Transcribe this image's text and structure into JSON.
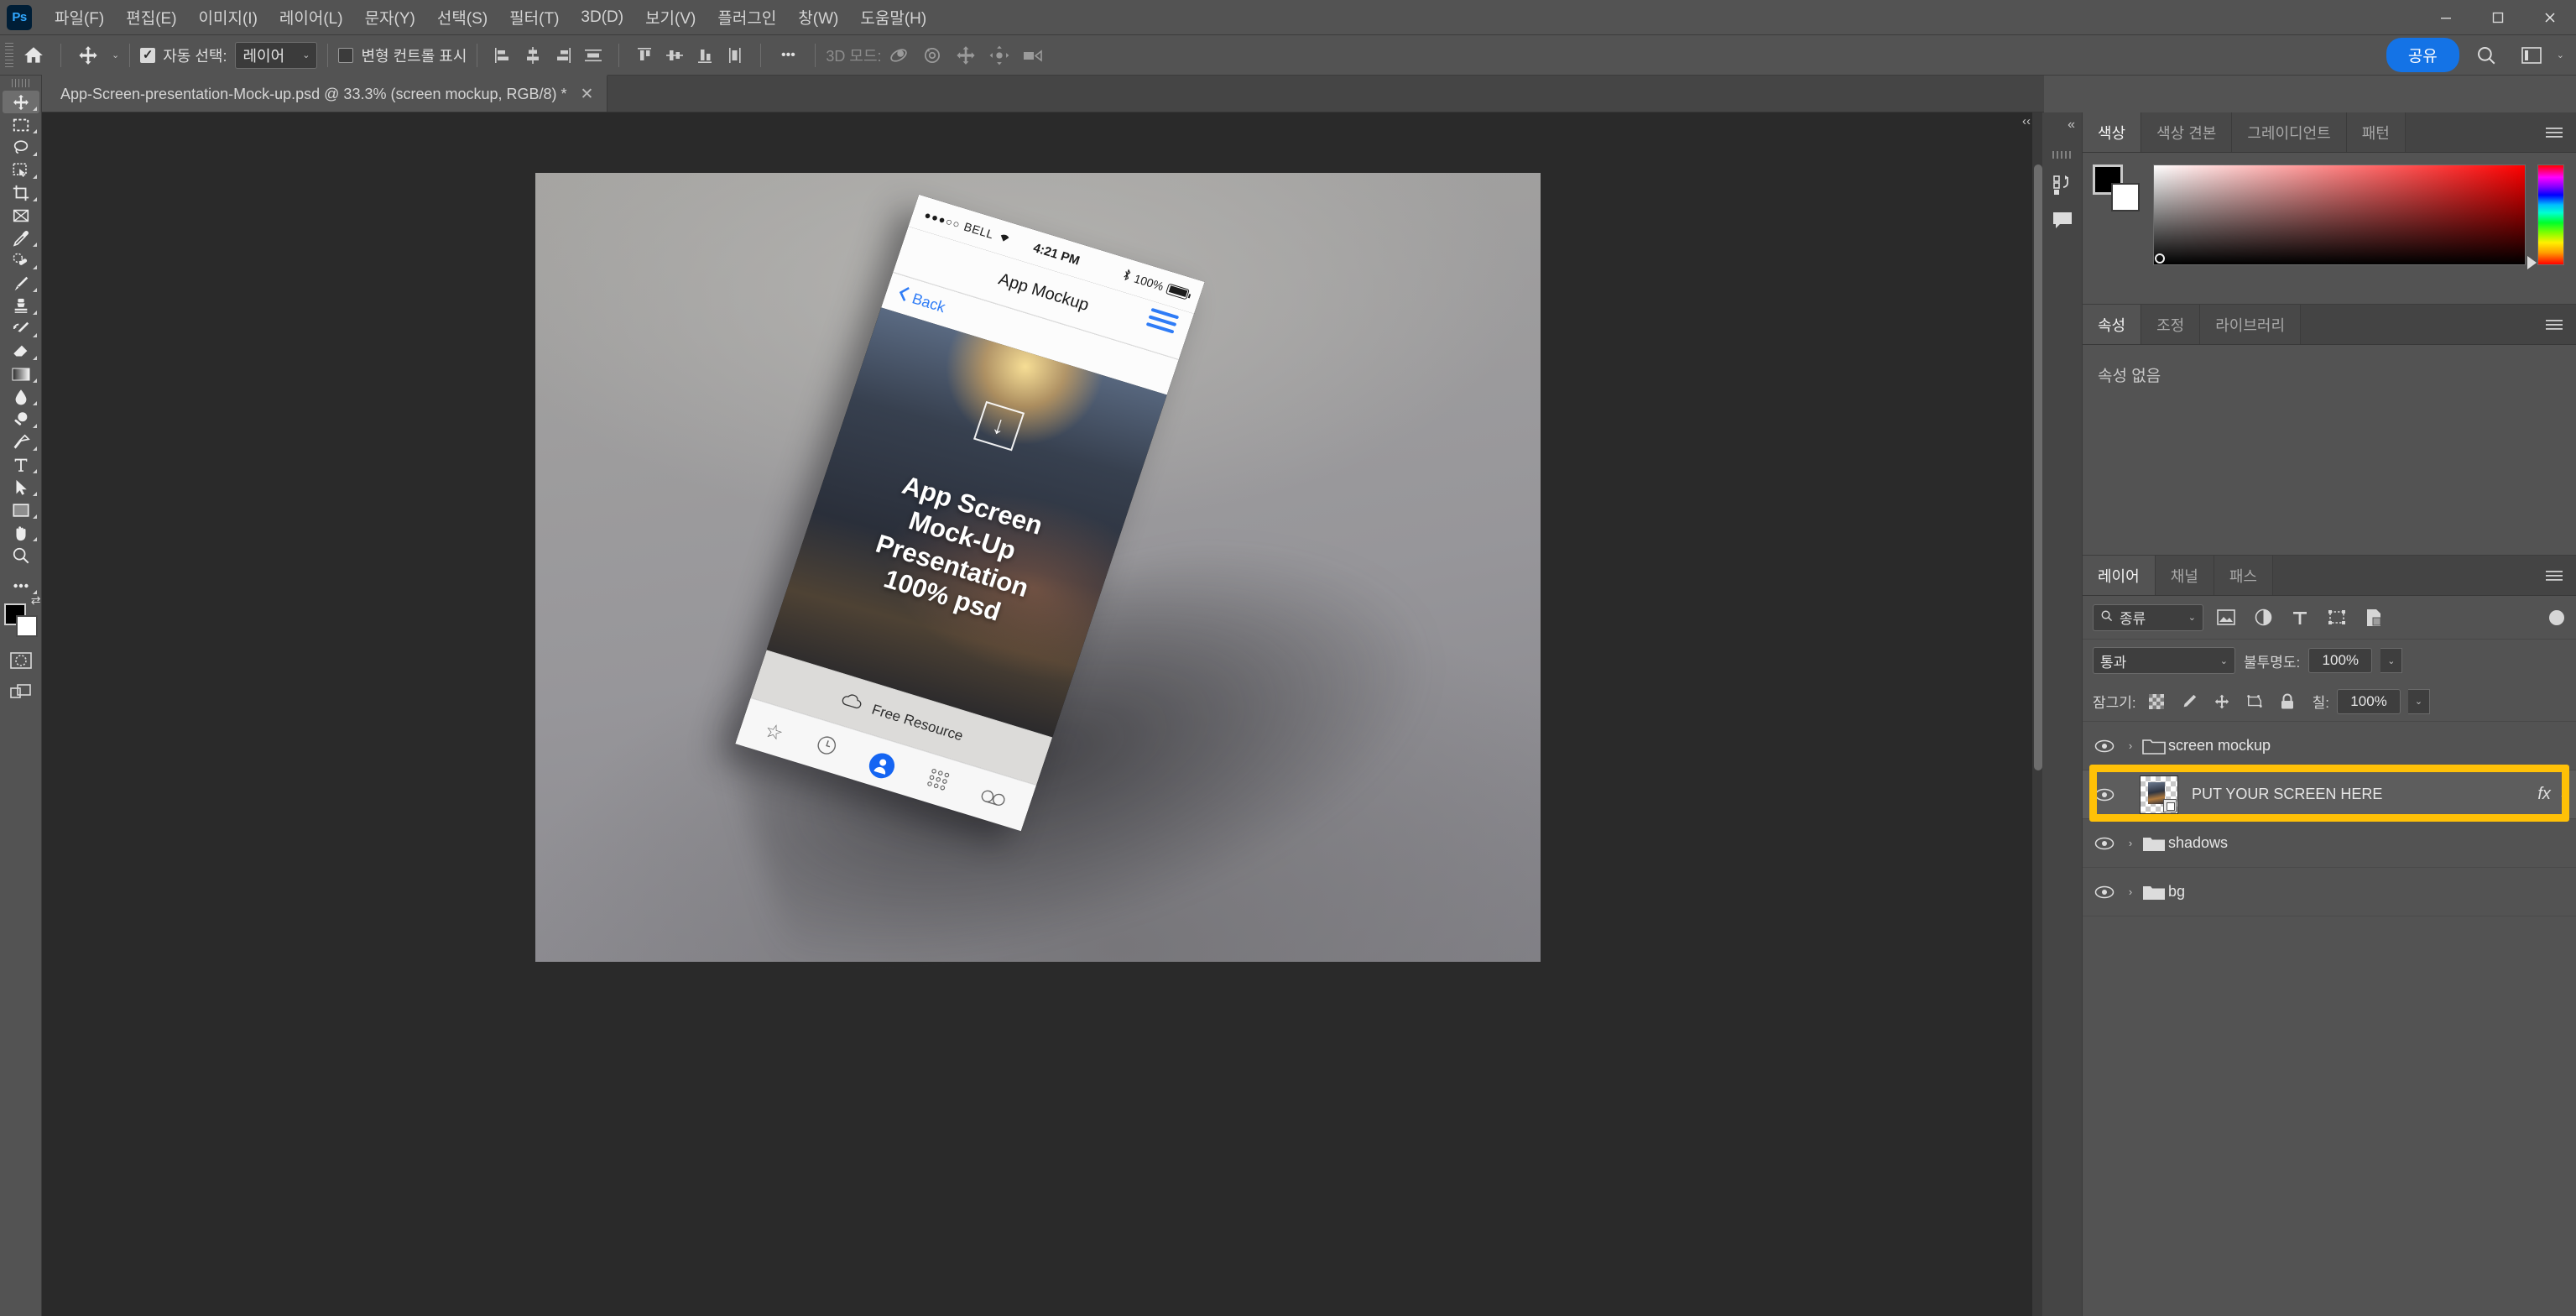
{
  "app": {
    "logo": "Ps"
  },
  "menubar": {
    "items": [
      {
        "label": "파일(F)"
      },
      {
        "label": "편집(E)"
      },
      {
        "label": "이미지(I)"
      },
      {
        "label": "레이어(L)"
      },
      {
        "label": "문자(Y)"
      },
      {
        "label": "선택(S)"
      },
      {
        "label": "필터(T)"
      },
      {
        "label": "3D(D)"
      },
      {
        "label": "보기(V)"
      },
      {
        "label": "플러그인"
      },
      {
        "label": "창(W)"
      },
      {
        "label": "도움말(H)"
      }
    ],
    "window_controls": {
      "minimize": "—",
      "maximize": "❐",
      "close": "✕"
    }
  },
  "options_bar": {
    "home_icon": "home-icon",
    "tool_icon": "move-tool-icon",
    "auto_select_checked": true,
    "auto_select_label": "자동 선택:",
    "auto_select_value": "레이어",
    "show_transform_checked": false,
    "show_transform_label": "변형 컨트롤 표시",
    "align_icons": [
      "align-left-icon",
      "align-center-h-icon",
      "align-right-icon",
      "distribute-h-icon"
    ],
    "align_icons_2": [
      "align-top-icon",
      "align-center-v-icon",
      "align-bottom-icon",
      "distribute-v-icon"
    ],
    "more_label": "•••",
    "mode_3d_label": "3D 모드:",
    "mode_3d_icons": [
      "orbit-3d-icon",
      "roll-3d-icon",
      "pan-3d-icon",
      "slide-3d-icon",
      "camera-3d-icon"
    ],
    "share_label": "공유",
    "search_icon": "search-icon",
    "workspace_icon": "workspace-icon",
    "workspace_caret": "⌄"
  },
  "document": {
    "tab_title": "App-Screen-presentation-Mock-up.psd @ 33.3% (screen mockup, RGB/8) *",
    "close_icon": "✕"
  },
  "toolbar": {
    "tools": [
      {
        "name": "move-tool",
        "glyph": "✥",
        "active": true,
        "more": true
      },
      {
        "name": "marquee-tool",
        "glyph": "▭",
        "active": false,
        "more": true
      },
      {
        "name": "lasso-tool",
        "glyph": "◯",
        "active": false,
        "more": true
      },
      {
        "name": "object-selection-tool",
        "glyph": "▨",
        "active": false,
        "more": true
      },
      {
        "name": "crop-tool",
        "glyph": "⌗",
        "active": false,
        "more": true
      },
      {
        "name": "frame-tool",
        "glyph": "⊠",
        "active": false,
        "more": false
      },
      {
        "name": "eyedropper-tool",
        "glyph": "⌇",
        "active": false,
        "more": true
      },
      {
        "name": "healing-brush-tool",
        "glyph": "✎",
        "active": false,
        "more": true
      },
      {
        "name": "brush-tool",
        "glyph": "🖌",
        "active": false,
        "more": true
      },
      {
        "name": "clone-stamp-tool",
        "glyph": "⎙",
        "active": false,
        "more": true
      },
      {
        "name": "history-brush-tool",
        "glyph": "↶",
        "active": false,
        "more": true
      },
      {
        "name": "eraser-tool",
        "glyph": "◣",
        "active": false,
        "more": true
      },
      {
        "name": "gradient-tool",
        "glyph": "▰",
        "active": false,
        "more": true
      },
      {
        "name": "blur-tool",
        "glyph": "💧",
        "active": false,
        "more": true
      },
      {
        "name": "dodge-tool",
        "glyph": "🔍",
        "active": false,
        "more": true
      },
      {
        "name": "pen-tool",
        "glyph": "✒",
        "active": false,
        "more": true
      },
      {
        "name": "type-tool",
        "glyph": "T",
        "active": false,
        "more": true
      },
      {
        "name": "path-selection-tool",
        "glyph": "➤",
        "active": false,
        "more": true
      },
      {
        "name": "rectangle-tool",
        "glyph": "▭",
        "active": false,
        "more": true
      },
      {
        "name": "hand-tool",
        "glyph": "✋",
        "active": false,
        "more": true
      },
      {
        "name": "zoom-tool",
        "glyph": "🔎",
        "active": false,
        "more": false
      },
      {
        "name": "edit-toolbar",
        "glyph": "•••",
        "active": false,
        "more": true
      }
    ],
    "foreground_color": "#000000",
    "background_color": "#ffffff",
    "swap_icon": "swap-colors-icon",
    "quickmask_icon": "quick-mask-icon",
    "screenmode_icon": "screen-mode-icon"
  },
  "canvas": {
    "zoom": "33.3%",
    "mockup": {
      "status_dots": "●●●○○",
      "carrier": "BELL",
      "wifi_icon": "wifi-icon",
      "time": "4:21 PM",
      "bluetooth_icon": "bluetooth-icon",
      "battery_percent": "100%",
      "nav_title": "App Mockup",
      "menu_icon": "hamburger-icon",
      "back_label": "Back",
      "back_icon": "chevron-left-icon",
      "download_icon": "download-box-icon",
      "headline_line1": "App Screen",
      "headline_line2": "Mock-Up",
      "headline_line3": "Presentation",
      "headline_line4": "100% psd",
      "free_label": "Free Resource",
      "cloud_icon": "cloud-icon",
      "tabs": [
        {
          "name": "favorites-tab",
          "icon": "star-icon",
          "selected": false
        },
        {
          "name": "recents-tab",
          "icon": "clock-icon",
          "selected": false
        },
        {
          "name": "contacts-tab",
          "icon": "person-icon",
          "selected": true
        },
        {
          "name": "keypad-tab",
          "icon": "keypad-icon",
          "selected": false
        },
        {
          "name": "voicemail-tab",
          "icon": "voicemail-icon",
          "selected": false
        }
      ]
    }
  },
  "rail": {
    "collapse_icon": "«",
    "buttons": [
      {
        "name": "history-panel-icon",
        "glyph": "↺"
      },
      {
        "name": "comments-panel-icon",
        "glyph": "💬"
      }
    ]
  },
  "color_panel": {
    "tabs": [
      {
        "label": "색상",
        "active": true
      },
      {
        "label": "색상 견본",
        "active": false
      },
      {
        "label": "그레이디언트",
        "active": false
      },
      {
        "label": "패턴",
        "active": false
      }
    ],
    "menu_icon": "panel-menu-icon",
    "foreground": "#000000",
    "background": "#ffffff",
    "field_hue": "#ff0000"
  },
  "properties_panel": {
    "tabs": [
      {
        "label": "속성",
        "active": true
      },
      {
        "label": "조정",
        "active": false
      },
      {
        "label": "라이브러리",
        "active": false
      }
    ],
    "menu_icon": "panel-menu-icon",
    "empty_text": "속성 없음"
  },
  "layers_panel": {
    "tabs": [
      {
        "label": "레이어",
        "active": true
      },
      {
        "label": "채널",
        "active": false
      },
      {
        "label": "패스",
        "active": false
      }
    ],
    "menu_icon": "panel-menu-icon",
    "filter": {
      "search_icon": "search-icon",
      "value": "종류",
      "caret": "⌄",
      "type_icons": [
        "pixel-filter-icon",
        "adjustment-filter-icon",
        "type-filter-icon",
        "shape-filter-icon",
        "smart-object-filter-icon"
      ],
      "toggle_name": "filter-enable-toggle"
    },
    "blend_mode": "통과",
    "opacity_label": "불투명도:",
    "opacity_value": "100%",
    "lock_label": "잠그기:",
    "lock_icons": [
      "lock-transparent-icon",
      "lock-image-icon",
      "lock-position-icon",
      "lock-artboard-icon",
      "lock-all-icon"
    ],
    "fill_label": "칠:",
    "fill_value": "100%",
    "layers": [
      {
        "name": "screen mockup",
        "type": "group",
        "visible": true,
        "selected": false,
        "expanded": false,
        "fx": false
      },
      {
        "name": "PUT YOUR SCREEN HERE",
        "type": "smart-object",
        "visible": true,
        "selected": true,
        "expanded": false,
        "fx": true,
        "fx_label": "fx",
        "fx_caret": "⌄"
      },
      {
        "name": "shadows",
        "type": "group",
        "visible": true,
        "selected": false,
        "expanded": false,
        "fx": false
      },
      {
        "name": "bg",
        "type": "group",
        "visible": true,
        "selected": false,
        "expanded": false,
        "fx": false
      }
    ],
    "highlight_color": "#FFC107",
    "highlighted_layer": "PUT YOUR SCREEN HERE"
  }
}
